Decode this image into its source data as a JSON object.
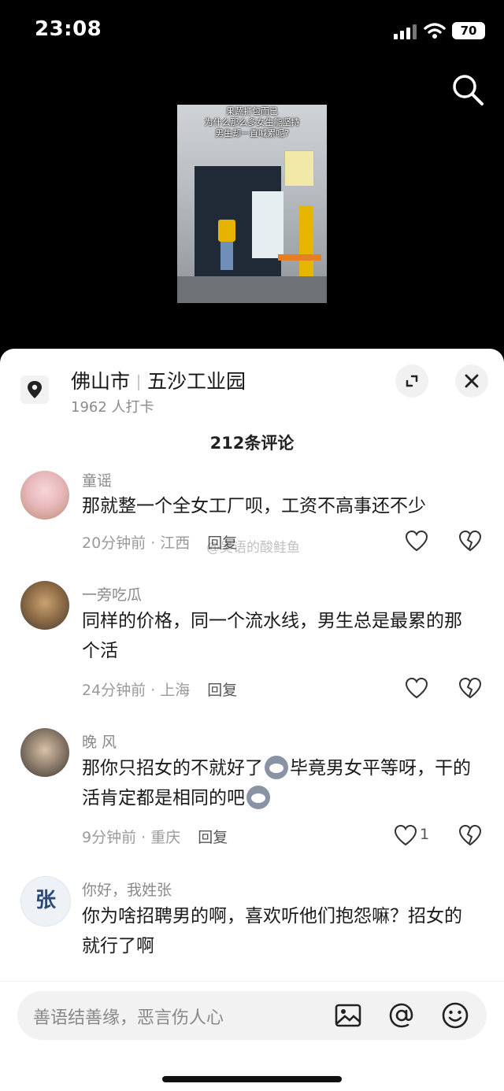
{
  "status_bar": {
    "time": "23:08",
    "battery": "70"
  },
  "video": {
    "caption_lines": [
      "果蔬打包而已",
      "为什么那么多女生能坚持",
      "男生却一直喊累呢?"
    ]
  },
  "location": {
    "city": "佛山市",
    "place": "五沙工业园",
    "checkins": "1962 人打卡"
  },
  "comments_count": "212条评论",
  "comments": [
    {
      "user": "童谣",
      "text": "那就整一个全女工厂呗，工资不高事还不少",
      "time": "20分钟前 · 江西",
      "reply": "回复",
      "likes": ""
    },
    {
      "user": "一旁吃瓜",
      "text": "同样的价格，同一个流水线，男生总是最累的那个活",
      "time": "24分钟前 · 上海",
      "reply": "回复",
      "likes": ""
    },
    {
      "user": "晚 风",
      "text_a": "那你只招女的不就好了",
      "text_b": "毕竟男女平等呀，干的活肯定都是相同的吧",
      "time": "9分钟前 · 重庆",
      "reply": "回复",
      "likes": "1"
    },
    {
      "user": "你好，我姓张",
      "text": "你为啥招聘男的啊，喜欢听他们抱怨嘛？招女的就行了啊",
      "avatar_text": "张"
    }
  ],
  "watermark": "@吴语的酸鲑鱼",
  "input": {
    "placeholder": "善语结善缘，恶言伤人心"
  },
  "icons": {
    "search": "search-icon",
    "location": "location-pin-icon",
    "expand": "expand-icon",
    "close": "close-icon",
    "like": "heart-icon",
    "dislike": "broken-heart-icon",
    "image": "image-icon",
    "mention": "at-icon",
    "emoji": "emoji-icon"
  }
}
